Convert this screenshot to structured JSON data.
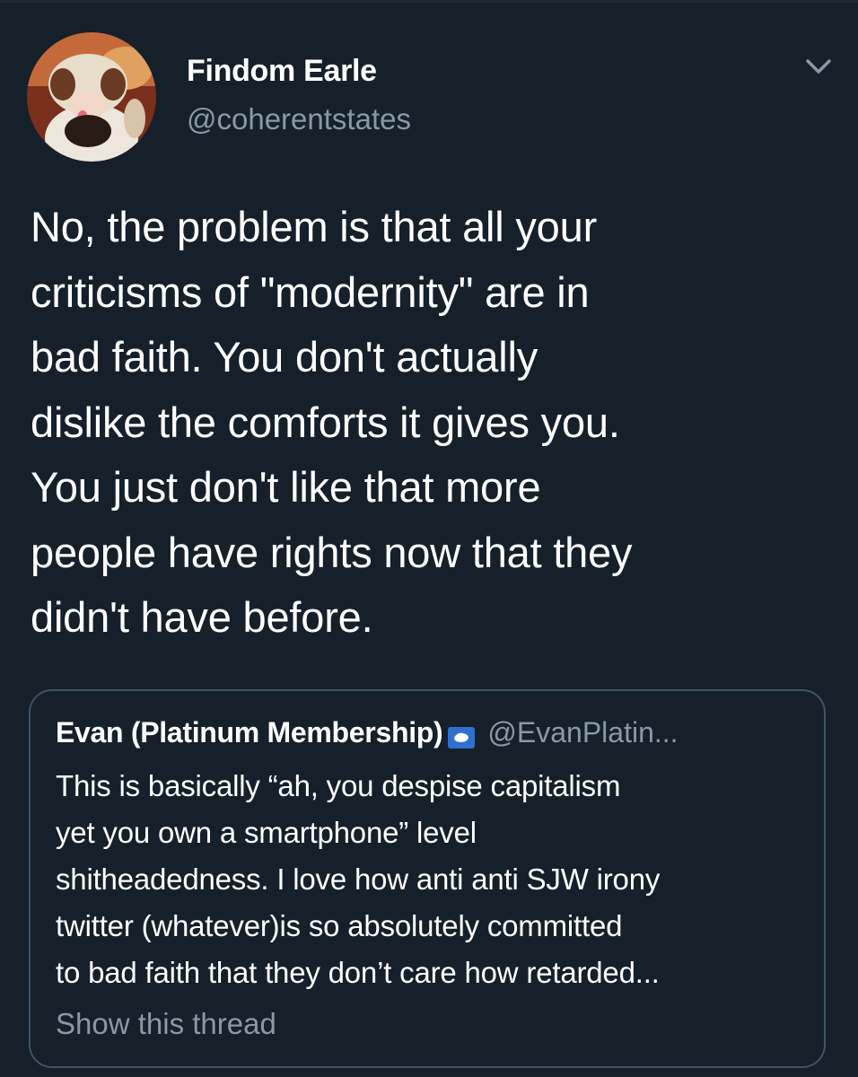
{
  "tweet": {
    "author": {
      "display_name": "Findom Earle",
      "handle": "@coherentstates"
    },
    "text": "No, the problem is that all your\ncriticisms of \"modernity\" are in\nbad faith. You don't actually\ndislike the comforts it gives you.\nYou just don't like that more\npeople have rights now that they\ndidn't have before.",
    "menu_icon": "chevron-down-icon"
  },
  "quoted_tweet": {
    "author": {
      "display_name": "Evan (Platinum Membership)",
      "handle": "@EvanPlatin...",
      "badge_icon": "antarctica-flag-icon"
    },
    "text": "This is basically “ah, you despise capitalism\nyet you own a smartphone” level\nshitheadedness. I love how anti anti SJW irony\ntwitter (whatever)is so absolutely committed\nto bad faith that they don’t care how retarded...",
    "show_thread_label": "Show this thread"
  },
  "colors": {
    "background": "#15202b",
    "text_primary": "#ffffff",
    "text_secondary": "#8899a6",
    "card_border": "#3d5466",
    "flag_blue": "#2f6fd0"
  }
}
